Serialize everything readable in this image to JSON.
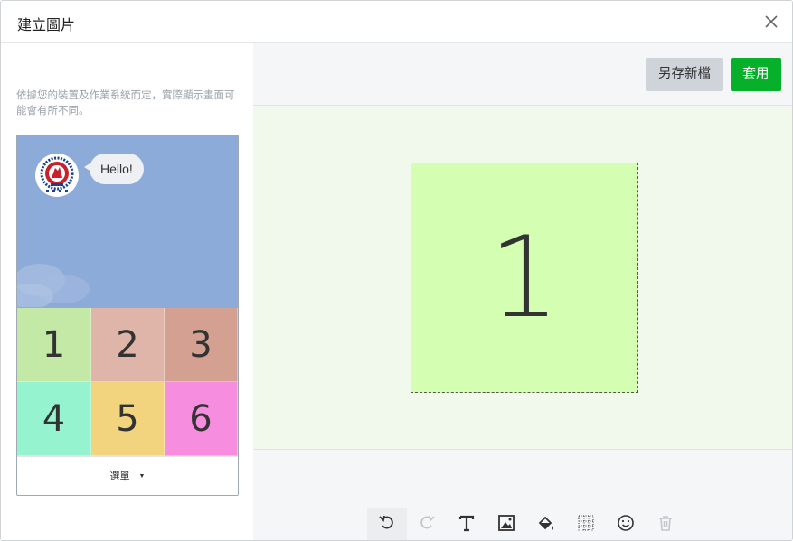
{
  "dialog": {
    "title": "建立圖片",
    "close_icon": "close-icon"
  },
  "left": {
    "hint": "依據您的裝置及作業系統而定，實際顯示畫面可能會有所不同。",
    "chat": {
      "message": "Hello!",
      "avatar_icon": "university-logo"
    },
    "grid": [
      {
        "label": "1",
        "color": "#c4e8a6"
      },
      {
        "label": "2",
        "color": "#dfb5a9"
      },
      {
        "label": "3",
        "color": "#d3a092"
      },
      {
        "label": "4",
        "color": "#96f3d0"
      },
      {
        "label": "5",
        "color": "#f3d47e"
      },
      {
        "label": "6",
        "color": "#f78ddf"
      }
    ],
    "menu_label": "選單",
    "menu_caret": "▼"
  },
  "right": {
    "save_new_label": "另存新檔",
    "apply_label": "套用",
    "apply_color": "#06b02a",
    "canvas_text": "1",
    "canvas_bg": "#d4ffb3",
    "tools": [
      "undo-icon",
      "redo-icon",
      "text-icon",
      "image-icon",
      "fill-icon",
      "grid-icon",
      "emoji-icon",
      "trash-icon"
    ]
  }
}
